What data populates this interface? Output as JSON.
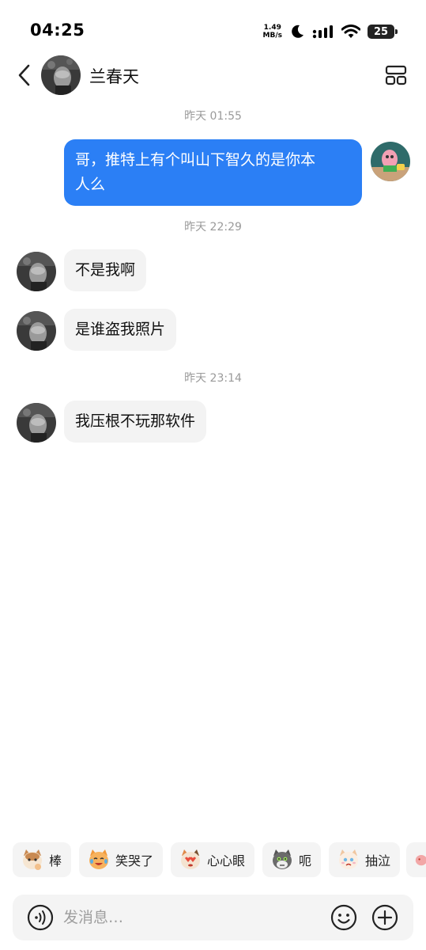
{
  "status_bar": {
    "time": "04:25",
    "net_speed_value": "1.49",
    "net_speed_unit": "MB/s",
    "battery": "25",
    "icons": [
      "moon-icon",
      "signal-icon",
      "wifi-icon",
      "battery-icon"
    ]
  },
  "header": {
    "contact_name": "兰春天",
    "icons": [
      "back-arrow-icon",
      "layout-grid-icon"
    ]
  },
  "messages": [
    {
      "type": "timestamp",
      "text": "昨天 01:55"
    },
    {
      "type": "outgoing",
      "line1": "哥，推特上有个叫山下智久的是你本",
      "line2": "人么"
    },
    {
      "type": "timestamp",
      "text": "昨天 22:29"
    },
    {
      "type": "incoming",
      "text": "不是我啊"
    },
    {
      "type": "incoming",
      "text": "是谁盗我照片"
    },
    {
      "type": "timestamp",
      "text": "昨天 23:14"
    },
    {
      "type": "incoming",
      "text": "我压根不玩那软件"
    }
  ],
  "stickers": [
    {
      "label": "棒",
      "icon": "cat-thumbs-up-icon"
    },
    {
      "label": "笑哭了",
      "icon": "cat-laugh-cry-icon"
    },
    {
      "label": "心心眼",
      "icon": "cat-heart-eyes-icon"
    },
    {
      "label": "呃",
      "icon": "cat-awkward-icon"
    },
    {
      "label": "抽泣",
      "icon": "cat-sob-icon"
    }
  ],
  "input": {
    "placeholder": "发消息…",
    "icons": [
      "voice-icon",
      "emoji-icon",
      "plus-icon"
    ]
  },
  "colors": {
    "outgoing_bubble": "#2b7ff5",
    "incoming_bubble": "#f3f3f3",
    "timestamp": "#9a9a9a",
    "background": "#ffffff"
  }
}
